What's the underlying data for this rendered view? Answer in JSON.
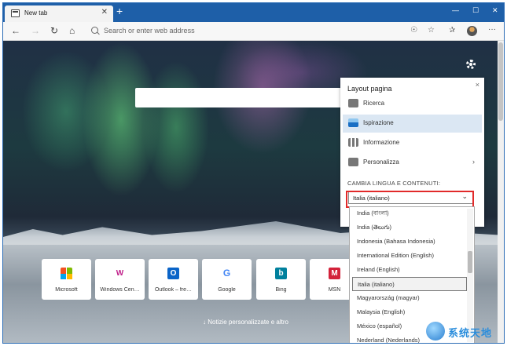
{
  "browser": {
    "tab_title": "New tab",
    "tab_close": "✕",
    "new_tab": "+",
    "window_controls": {
      "minimize": "—",
      "maximize": "☐",
      "close": "✕"
    }
  },
  "toolbar": {
    "back": "←",
    "forward": "→",
    "refresh": "↻",
    "home": "⌂",
    "address_placeholder": "Search or enter web address",
    "read_aloud": "☉",
    "favorite": "☆",
    "favorites_hub": "✰",
    "more": "···"
  },
  "page": {
    "settings_icon": "gear-icon",
    "news_label": "↓  Notizie personalizzate e altro"
  },
  "tiles": [
    {
      "label": "Microsoft",
      "logo": "",
      "color": "#ffffff"
    },
    {
      "label": "Windows Cen…",
      "logo": "W",
      "color": "#c0208a"
    },
    {
      "label": "Outlook – fre…",
      "logo": "O",
      "color": "#0a64c8"
    },
    {
      "label": "Google",
      "logo": "G",
      "color": "#ffffff"
    },
    {
      "label": "Bing",
      "logo": "b",
      "color": "#00809d"
    },
    {
      "label": "MSN",
      "logo": "M",
      "color": "#d3223a"
    }
  ],
  "panel": {
    "title": "Layout pagina",
    "close": "×",
    "options": [
      {
        "label": "Ricerca",
        "icon": "search-layout-icon",
        "color": "#777777",
        "selected": false
      },
      {
        "label": "Ispirazione",
        "icon": "image-layout-icon",
        "color": "#1a6fc4",
        "selected": true
      },
      {
        "label": "Informazione",
        "icon": "info-layout-icon",
        "color": "#777777",
        "selected": false
      },
      {
        "label": "Personalizza",
        "icon": "pencil-icon",
        "color": "#777777",
        "selected": false
      }
    ],
    "section_label": "CAMBIA LINGUA E CONTENUTI:",
    "language_selected": "Italia (italiano)",
    "chevron": "⌄"
  },
  "language_options": [
    "India (বাংলা)",
    "India (తెలుగు)",
    "Indonesia (Bahasa Indonesia)",
    "International Edition (English)",
    "Ireland (English)",
    "Italia (italiano)",
    "Magyarország (magyar)",
    "Malaysia (English)",
    "México (español)",
    "Nederland (Nederlands)"
  ],
  "language_selected_index": 5,
  "watermark": {
    "text": "系统天地"
  }
}
